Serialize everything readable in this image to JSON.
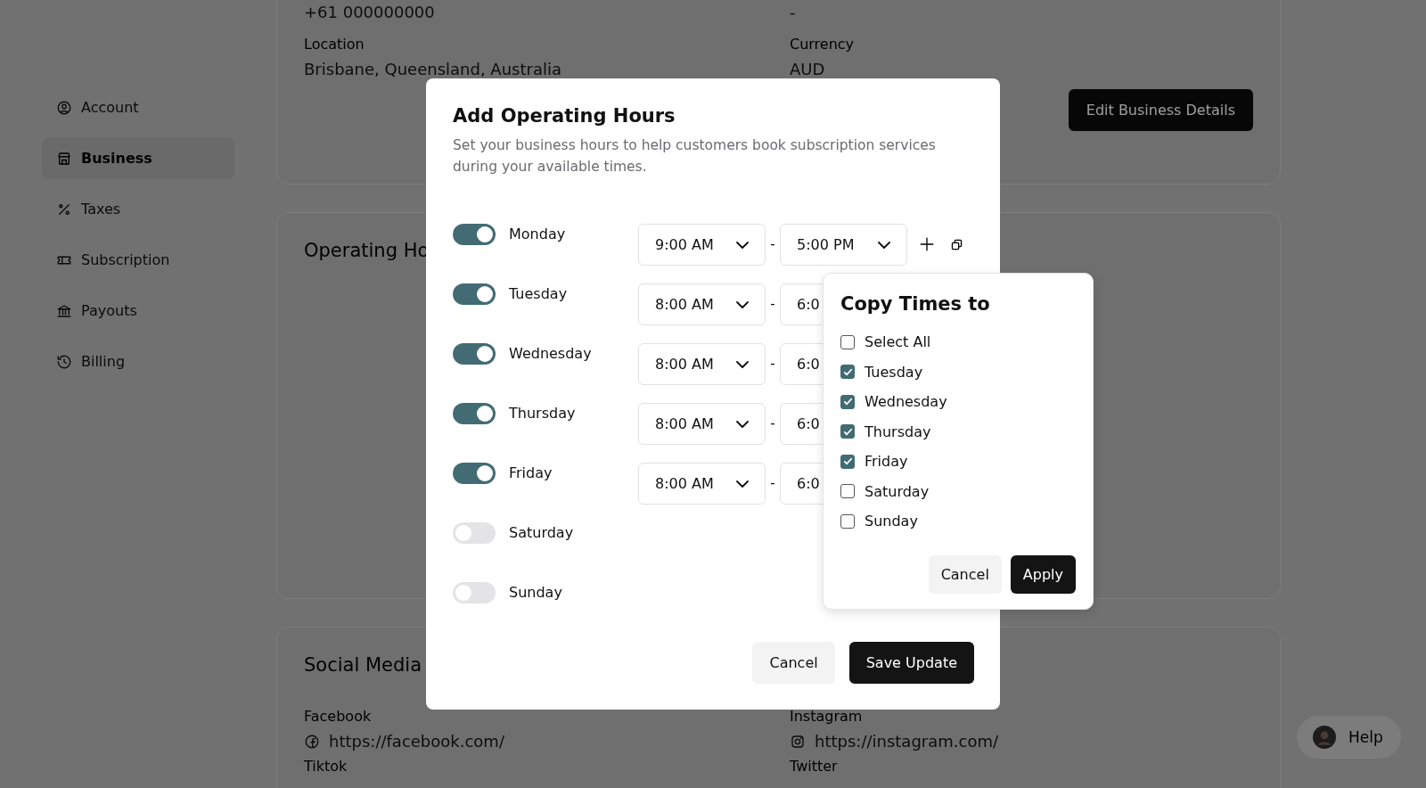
{
  "sidebar": {
    "items": [
      {
        "label": "Account",
        "selected": false
      },
      {
        "label": "Business",
        "selected": true
      },
      {
        "label": "Taxes",
        "selected": false
      },
      {
        "label": "Subscription",
        "selected": false
      },
      {
        "label": "Payouts",
        "selected": false
      },
      {
        "label": "Billing",
        "selected": false
      }
    ]
  },
  "business_card": {
    "top_values": [
      "+61 000000000",
      "-"
    ],
    "fields": [
      {
        "label": "Location",
        "value": "Brisbane, Queensland, Australia"
      },
      {
        "label": "Currency",
        "value": "AUD"
      }
    ],
    "button": "Edit Business Details"
  },
  "operating_hours_card": {
    "title": "Operating Ho"
  },
  "social_card": {
    "title": "Social Media",
    "fields": [
      {
        "label": "Facebook",
        "value": "https://facebook.com/"
      },
      {
        "label": "Instagram",
        "value": "https://instagram.com/"
      }
    ],
    "next_labels": [
      "Tiktok",
      "Twitter"
    ]
  },
  "help_button": {
    "label": "Help"
  },
  "modal": {
    "title": "Add Operating Hours",
    "description": "Set your business hours to help customers book subscription services during your available times.",
    "days": [
      {
        "name": "Monday",
        "on": true,
        "start": "9:00 AM",
        "end": "5:00 PM"
      },
      {
        "name": "Tuesday",
        "on": true,
        "start": "8:00 AM",
        "end": "6:0"
      },
      {
        "name": "Wednesday",
        "on": true,
        "start": "8:00 AM",
        "end": "6:0"
      },
      {
        "name": "Thursday",
        "on": true,
        "start": "8:00 AM",
        "end": "6:0"
      },
      {
        "name": "Friday",
        "on": true,
        "start": "8:00 AM",
        "end": "6:0"
      },
      {
        "name": "Saturday",
        "on": false
      },
      {
        "name": "Sunday",
        "on": false
      }
    ],
    "separator": "-",
    "cancel": "Cancel",
    "save": "Save Update"
  },
  "copy_popup": {
    "title": "Copy Times to",
    "options": [
      {
        "label": "Select All",
        "checked": false
      },
      {
        "label": "Tuesday",
        "checked": true
      },
      {
        "label": "Wednesday",
        "checked": true
      },
      {
        "label": "Thursday",
        "checked": true
      },
      {
        "label": "Friday",
        "checked": true
      },
      {
        "label": "Saturday",
        "checked": false
      },
      {
        "label": "Sunday",
        "checked": false
      }
    ],
    "cancel": "Cancel",
    "apply": "Apply"
  }
}
